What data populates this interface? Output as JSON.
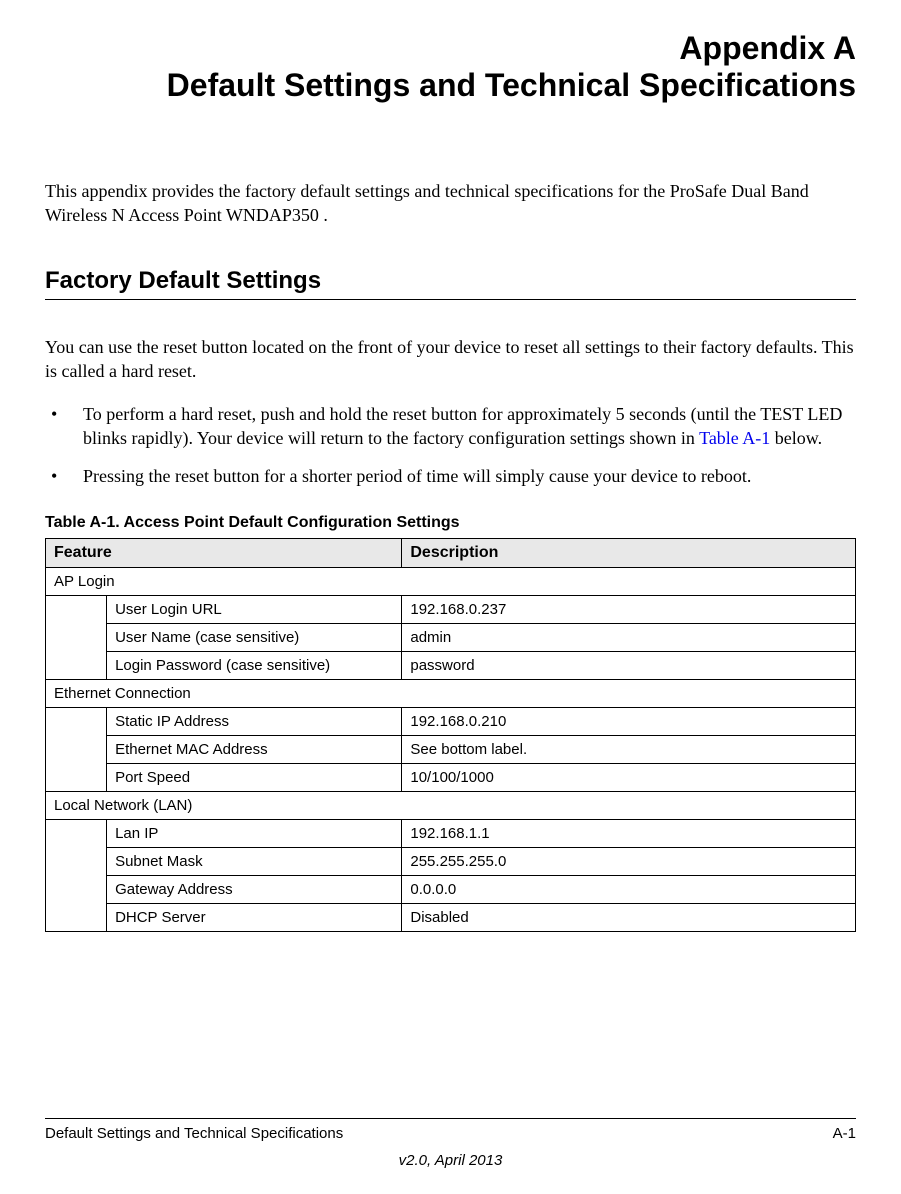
{
  "header": {
    "appendix_label": "Appendix A",
    "appendix_title": "Default Settings and Technical Specifications"
  },
  "intro": "This appendix provides the factory default settings and technical specifications for the ProSafe Dual Band Wireless N Access Point WNDAP350 .",
  "section": {
    "heading": "Factory Default Settings",
    "intro": "You can use the reset button located on the front of your device to reset all settings to their factory defaults. This is called a hard reset.",
    "bullets": [
      {
        "pre": "To perform a hard reset, push and hold the reset button for approximately 5 seconds (until the TEST LED blinks rapidly). Your device will return to the factory configuration settings shown in ",
        "link": "Table A-1",
        "post": " below."
      },
      {
        "text": "Pressing the reset button for a shorter period of time will simply cause your device to reboot."
      }
    ]
  },
  "table": {
    "caption": "Table A-1.  Access Point Default Configuration Settings",
    "headers": {
      "feature": "Feature",
      "description": "Description"
    },
    "sections": [
      {
        "title": "AP Login",
        "rows": [
          {
            "feature": "User Login URL",
            "description": "192.168.0.237"
          },
          {
            "feature": "User Name (case sensitive)",
            "description": "admin"
          },
          {
            "feature": "Login Password (case sensitive)",
            "description": "password"
          }
        ]
      },
      {
        "title": "Ethernet Connection",
        "rows": [
          {
            "feature": "Static IP Address",
            "description": "192.168.0.210"
          },
          {
            "feature": "Ethernet MAC Address",
            "description": "See bottom label."
          },
          {
            "feature": "Port Speed",
            "description": "10/100/1000"
          }
        ]
      },
      {
        "title": "Local Network (LAN)",
        "rows": [
          {
            "feature": "Lan IP",
            "description": "192.168.1.1"
          },
          {
            "feature": "Subnet Mask",
            "description": "255.255.255.0"
          },
          {
            "feature": "Gateway Address",
            "description": "0.0.0.0"
          },
          {
            "feature": "DHCP Server",
            "description": "Disabled"
          }
        ]
      }
    ]
  },
  "footer": {
    "left": "Default Settings and Technical Specifications",
    "right": "A-1",
    "version": "v2.0, April 2013"
  }
}
